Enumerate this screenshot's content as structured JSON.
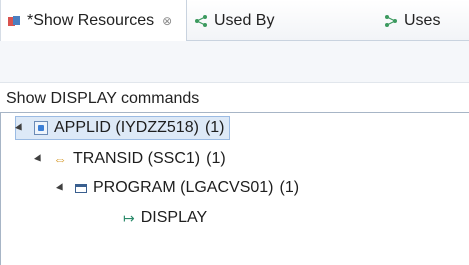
{
  "tabs": [
    {
      "label": "*Show Resources",
      "close": "⊗",
      "active": true,
      "icon": "resources-icon"
    },
    {
      "label": "Used By",
      "active": false,
      "icon": "used-by-icon"
    },
    {
      "label": "Uses",
      "active": false,
      "icon": "uses-icon"
    }
  ],
  "section_label": "Show DISPLAY commands",
  "tree": [
    {
      "label": "APPLID (IYDZZ518)",
      "count": "(1)",
      "icon": "applid-icon",
      "selected": true
    },
    {
      "label": "TRANSID (SSC1)",
      "count": "(1)",
      "icon": "transid-icon"
    },
    {
      "label": "PROGRAM (LGACVS01)",
      "count": "(1)",
      "icon": "program-icon"
    },
    {
      "label": "DISPLAY",
      "icon": "display-command-icon"
    }
  ]
}
